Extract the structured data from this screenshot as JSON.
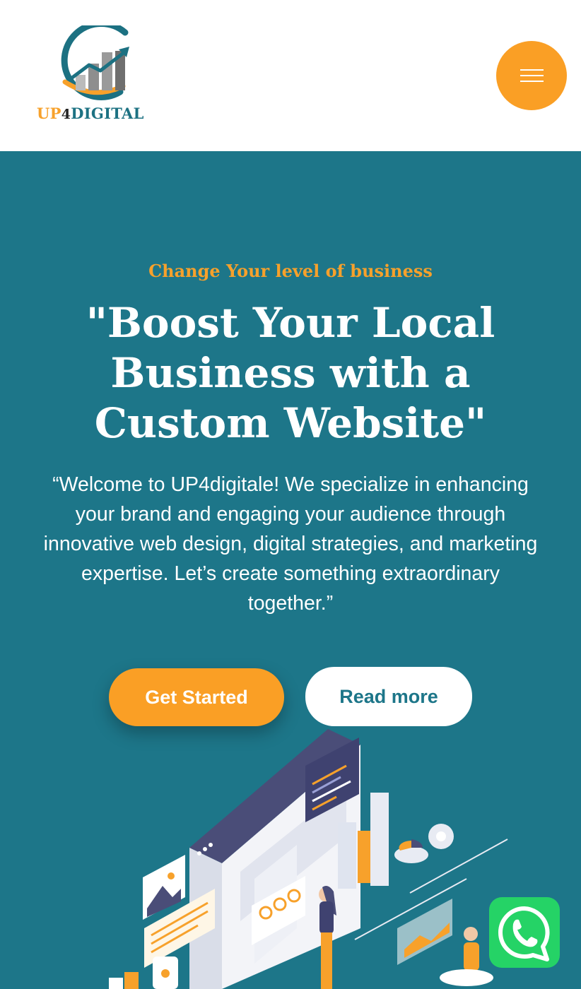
{
  "header": {
    "logo": {
      "part1": "UP",
      "part2": "4",
      "part3": "DIGITAL"
    },
    "menu_icon": "hamburger-icon"
  },
  "hero": {
    "tagline": "Change Your level of business",
    "title": "\"Boost Your Local Business with a Custom Website\"",
    "intro": "“Welcome to UP4digitale! We specialize in enhancing your brand and engaging your audience through innovative web design, digital strategies, and marketing expertise. Let’s create something extraordinary together.”",
    "buttons": {
      "primary": "Get Started",
      "secondary": "Read more"
    }
  },
  "floating": {
    "whatsapp_icon": "whatsapp-icon"
  },
  "colors": {
    "accent": "#fa9f25",
    "hero_bg": "#1d7689",
    "whatsapp": "#25d366"
  }
}
